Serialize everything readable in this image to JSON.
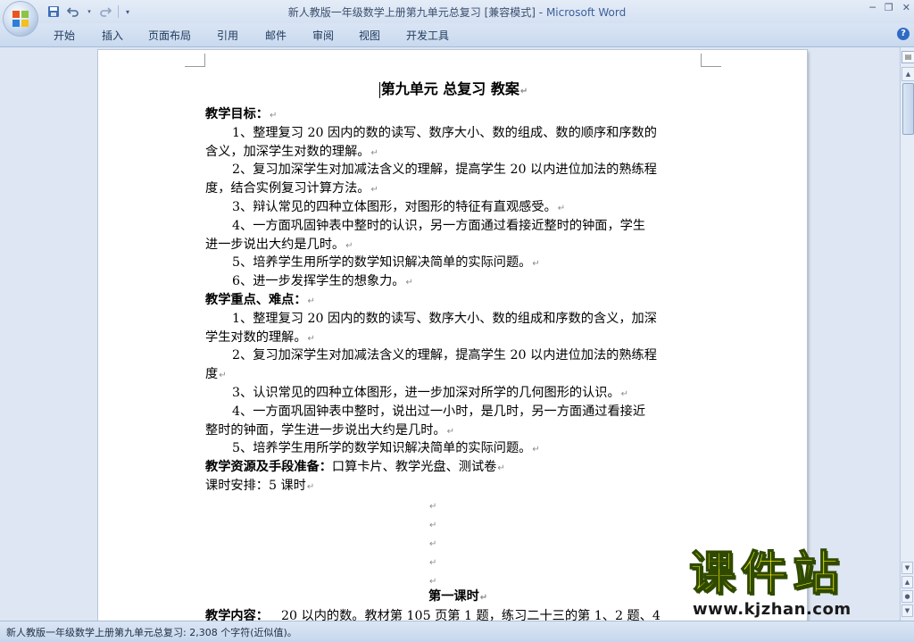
{
  "window": {
    "doc_title": "新人教版一年级数学上册第九单元总复习 [兼容模式]",
    "separator": " - ",
    "app_name": "Microsoft Word",
    "controls": {
      "minimize": "─",
      "restore": "❐",
      "close": "✕"
    }
  },
  "quick_access": {
    "save_icon": "save-icon",
    "undo_icon": "undo-icon",
    "redo_icon": "redo-icon",
    "customize_icon": "customize-icon"
  },
  "ribbon": {
    "tabs": [
      "开始",
      "插入",
      "页面布局",
      "引用",
      "邮件",
      "审阅",
      "视图",
      "开发工具"
    ],
    "help": "?"
  },
  "document": {
    "title": "第九单元    总复习 教案",
    "lines": [
      {
        "text": "教学目标：",
        "bold": true
      },
      {
        "text": "1、整理复习 20 因内的数的读写、数序大小、数的组成、数的顺序和序数的",
        "indent": true,
        "nomark": true
      },
      {
        "text": "含义，加深学生对数的理解。"
      },
      {
        "text": "2、复习加深学生对加减法含义的理解，提高学生 20 以内进位加法的熟练程",
        "indent": true,
        "nomark": true
      },
      {
        "text": "度，结合实例复习计算方法。"
      },
      {
        "text": "3、辩认常见的四种立体图形，对图形的特征有直观感受。",
        "indent": true
      },
      {
        "text": "4、一方面巩固钟表中整时的认识，另一方面通过看接近整时的钟面，学生",
        "indent": true,
        "nomark": true
      },
      {
        "text": "进一步说出大约是几时。"
      },
      {
        "text": "5、培养学生用所学的数学知识解决简单的实际问题。",
        "indent": true
      },
      {
        "text": "6、进一步发挥学生的想象力。",
        "indent": true
      },
      {
        "text": "教学重点、难点：",
        "bold": true
      },
      {
        "text": "1、整理复习 20 因内的数的读写、数序大小、数的组成和序数的含义，加深",
        "indent": true,
        "nomark": true
      },
      {
        "text": "学生对数的理解。"
      },
      {
        "text": "2、复习加深学生对加减法含义的理解，提高学生 20 以内进位加法的熟练程",
        "indent": true,
        "nomark": true
      },
      {
        "text": "度"
      },
      {
        "text": "3、认识常见的四种立体图形，进一步加深对所学的几何图形的认识。",
        "indent": true
      },
      {
        "text": "4、一方面巩固钟表中整时，说出过一小时，是几时，另一方面通过看接近",
        "indent": true,
        "nomark": true
      },
      {
        "text": "整时的钟面，学生进一步说出大约是几时。"
      },
      {
        "text": "5、培养学生用所学的数学知识解决简单的实际问题。",
        "indent": true
      },
      {
        "text_bold": "教学资源及手段准备：",
        "text": "口算卡片、教学光盘、测试卷"
      },
      {
        "text": "课时安排：5 课时"
      }
    ],
    "empty_mark": "↵",
    "empty_count": 5,
    "subtitle": "第一课时",
    "last_line_bold": "教学内容：",
    "last_line_text": "20 以内的数。教材第 105 页第 1 题，练习二十三的第 1、2 题、4"
  },
  "status_bar": {
    "text": "新人教版一年级数学上册第九单元总复习: 2,308 个字符(近似值)。"
  },
  "watermark": {
    "main": "课件站",
    "url": "www.kjzhan.com"
  }
}
